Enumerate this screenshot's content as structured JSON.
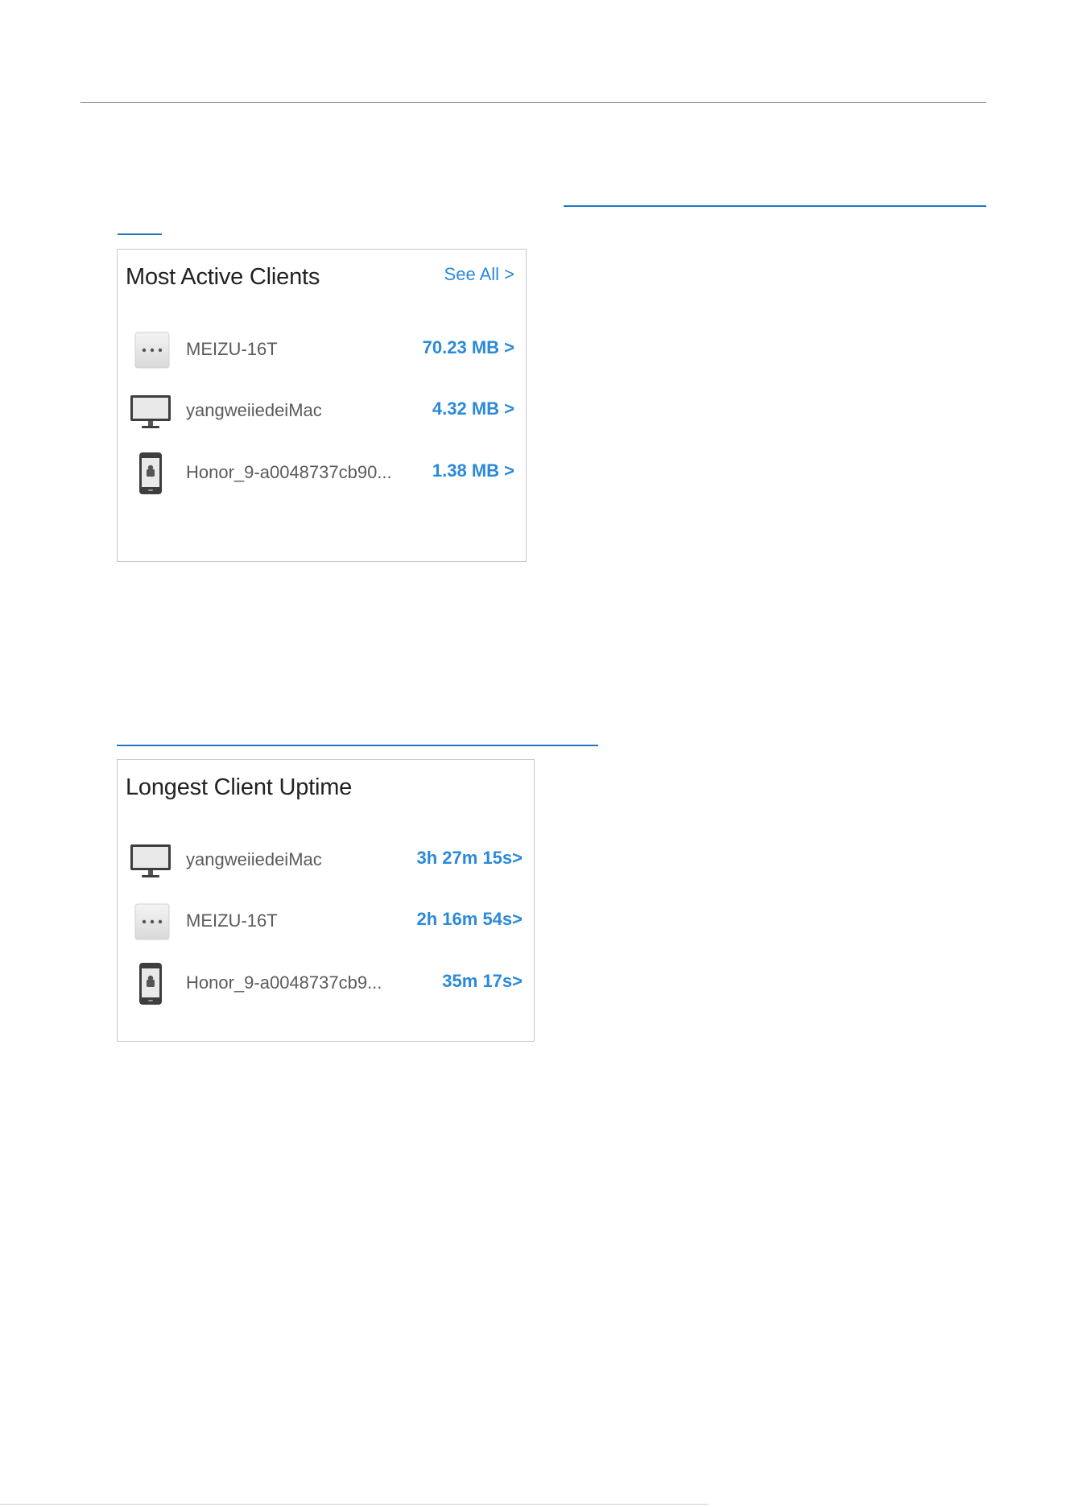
{
  "active_clients": {
    "title": "Most Active Clients",
    "see_all_label": "See All >",
    "rows": [
      {
        "icon": "more-dots-icon",
        "name": "MEIZU-16T",
        "value": "70.23 MB >"
      },
      {
        "icon": "monitor-icon",
        "name": "yangweiiedeiMac",
        "value": "4.32 MB >"
      },
      {
        "icon": "android-phone-icon",
        "name": "Honor_9-a0048737cb90...",
        "value": "1.38 MB >"
      }
    ]
  },
  "uptime_clients": {
    "title": "Longest Client Uptime",
    "rows": [
      {
        "icon": "monitor-icon",
        "name": "yangweiiedeiMac",
        "value": "3h 27m 15s>"
      },
      {
        "icon": "more-dots-icon",
        "name": "MEIZU-16T",
        "value": "2h 16m 54s>"
      },
      {
        "icon": "android-phone-icon",
        "name": "Honor_9-a0048737cb9...",
        "value": "35m 17s>"
      }
    ]
  },
  "colors": {
    "accent": "#2b8ad8",
    "link_underline": "#1f77c4",
    "border": "#c8c8c8"
  }
}
